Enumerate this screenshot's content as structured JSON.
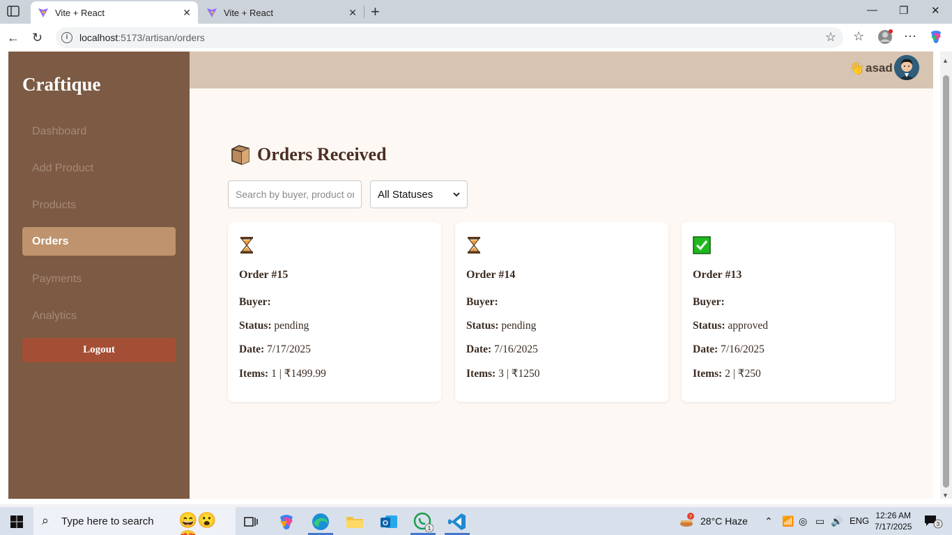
{
  "browser": {
    "tabs": [
      {
        "title": "Vite + React",
        "active": true
      },
      {
        "title": "Vite + React",
        "active": false
      }
    ],
    "url_host": "localhost",
    "url_rest": ":5173/artisan/orders"
  },
  "sidebar": {
    "brand": "Craftique",
    "items": [
      {
        "label": "Dashboard",
        "active": false
      },
      {
        "label": "Add Product",
        "active": false
      },
      {
        "label": "Products",
        "active": false
      },
      {
        "label": "Orders",
        "active": true
      },
      {
        "label": "Payments",
        "active": false
      },
      {
        "label": "Analytics",
        "active": false
      }
    ],
    "logout_label": "Logout"
  },
  "header": {
    "wave_icon": "👋",
    "username": "asad"
  },
  "main": {
    "title_icon": "📦",
    "title": "Orders Received",
    "search_placeholder": "Search by buyer, product or ID",
    "status_filter": "All Statuses",
    "labels": {
      "buyer": "Buyer:",
      "status": "Status:",
      "date": "Date:",
      "items": "Items:"
    },
    "orders": [
      {
        "status_icon": "hourglass",
        "number": "Order #15",
        "buyer": "",
        "status": "pending",
        "date": "7/17/2025",
        "items": "1 | ₹1499.99"
      },
      {
        "status_icon": "hourglass",
        "number": "Order #14",
        "buyer": "",
        "status": "pending",
        "date": "7/16/2025",
        "items": "3 | ₹1250"
      },
      {
        "status_icon": "check",
        "number": "Order #13",
        "buyer": "",
        "status": "approved",
        "date": "7/16/2025",
        "items": "2 | ₹250"
      }
    ]
  },
  "taskbar": {
    "search_text": "Type here to search",
    "weather_badge": "7",
    "weather": "28°C  Haze",
    "lang": "ENG",
    "time": "12:26 AM",
    "date": "7/17/2025",
    "notif_count": "3",
    "whatsapp_badge": "1"
  },
  "colors": {
    "sidebar_bg": "#7c5a43",
    "active_nav": "#be936d",
    "logout_bg": "#a44f35",
    "header_bg": "#d7c4b1",
    "page_bg": "#fdf8f4",
    "title_color": "#4b2f22"
  }
}
